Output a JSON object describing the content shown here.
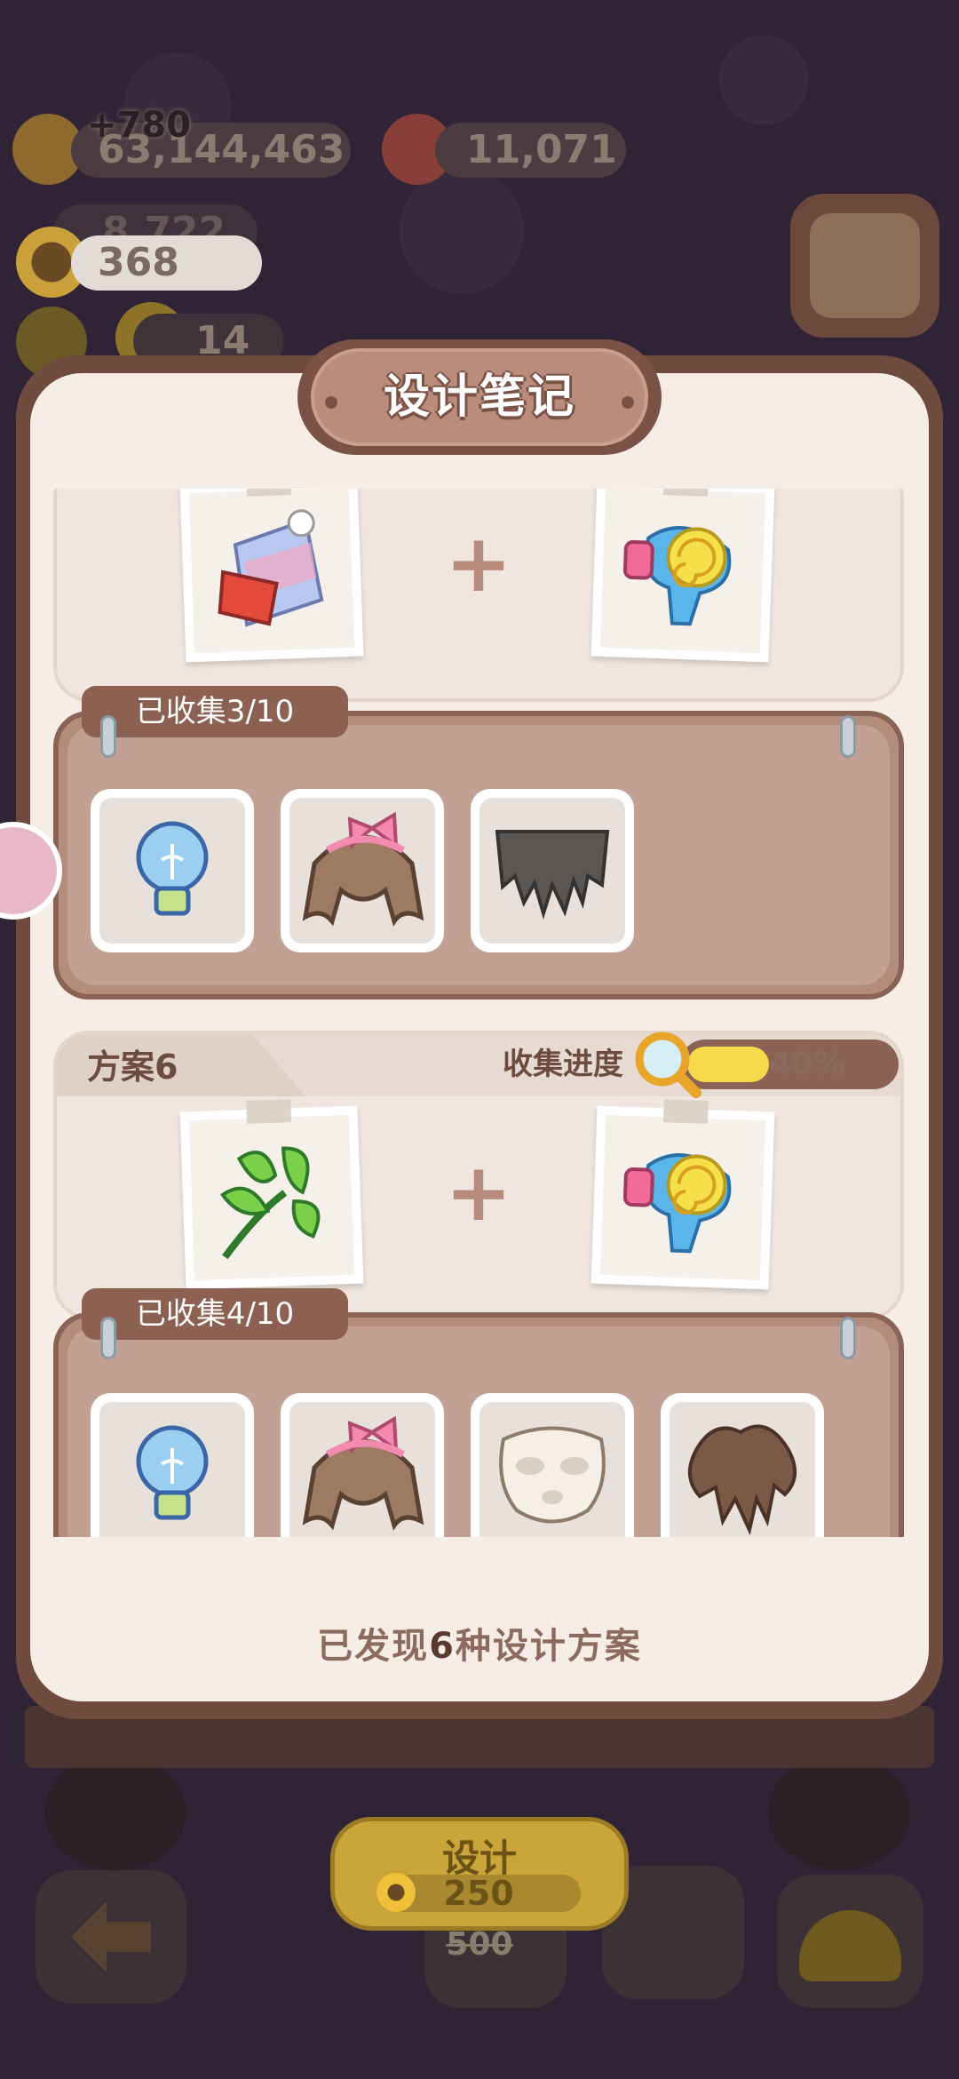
{
  "hud": {
    "coins_gain": "+780",
    "coins_value": "63,144,463",
    "gems_value": "11,071",
    "hidden_value": "8,722",
    "sunflower_value": "368",
    "duck_value": "14"
  },
  "dialog": {
    "title": "设计笔记",
    "recipe_5": {
      "collected_label": "已收集3/10",
      "items": [
        "lightbulb-icon",
        "pink-bow-hair-icon",
        "dark-fringe-hair-icon"
      ]
    },
    "recipe_6": {
      "name": "方案6",
      "progress_label": "收集进度",
      "progress_percent": "40%",
      "progress_fraction": 0.4,
      "collected_label": "已收集4/10",
      "items": [
        "lightbulb-icon",
        "pink-bow-hair-icon",
        "face-mask-icon",
        "brown-hair-icon"
      ]
    },
    "footer_prefix": "已发现",
    "footer_count": "6",
    "footer_suffix": "种设计方案"
  },
  "bottom": {
    "design_label": "设计",
    "cost": "250",
    "old_cost": "500"
  },
  "colors": {
    "accent_yellow": "#f7d94c",
    "dialog_brown": "#6f4b3e",
    "panel_cream": "#f5ede6"
  }
}
